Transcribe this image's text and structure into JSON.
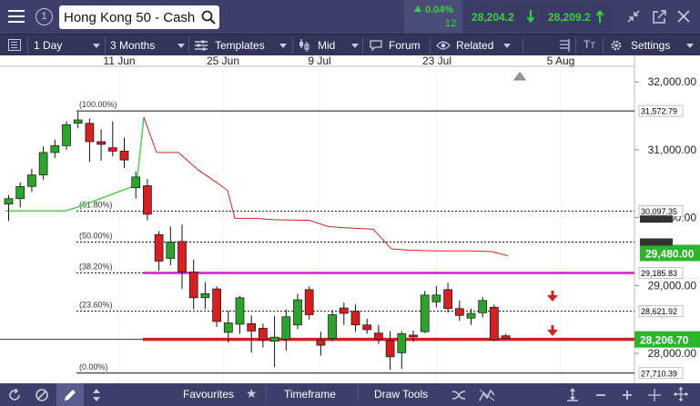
{
  "header": {
    "instrument": "Hong Kong 50 - Cash",
    "change_pct": "0.04%",
    "change_count": "12",
    "sell_price": "28,204.2",
    "buy_price": "28,209.2"
  },
  "toolbar": {
    "interval": "1 Day",
    "range": "3 Months",
    "templates": "Templates",
    "price_type": "Mid",
    "forum": "Forum",
    "related": "Related",
    "settings": "Settings"
  },
  "bottombar": {
    "favourites": "Favourites",
    "timeframe": "Timeframe",
    "draw_tools": "Draw Tools"
  },
  "chart_data": {
    "type": "candlestick",
    "x_tick_labels": [
      "11 Jun",
      "25 Jun",
      "9 Jul",
      "23 Jul",
      "5 Aug"
    ],
    "y_tick_labels": [
      "32,000.00",
      "31,000.00",
      "30,000.00",
      "29,000.00",
      "28,000.00"
    ],
    "ylim": [
      27560,
      32230
    ],
    "fib_levels": [
      {
        "label": "(100.00%)",
        "value": 31572.79,
        "tag": "31,572.79"
      },
      {
        "label": "(61.80%)",
        "value": 30097.35,
        "tag": "30,097.35"
      },
      {
        "label": "(50.00%)",
        "value": 29641,
        "tag": ""
      },
      {
        "label": "(38.20%)",
        "value": 29185.83,
        "tag": "29,185.83"
      },
      {
        "label": "(23.60%)",
        "value": 28621.92,
        "tag": "28,621.92"
      },
      {
        "label": "(0.00%)",
        "value": 27710.39,
        "tag": "27,710.39"
      }
    ],
    "current_price": {
      "value": 28206.7,
      "label": "28,206.70"
    },
    "indicator_value": {
      "value": 29480,
      "label": "29,480.00"
    },
    "candles": [
      {
        "o": 30200,
        "h": 30330,
        "l": 29950,
        "c": 30280
      },
      {
        "o": 30280,
        "h": 30520,
        "l": 30150,
        "c": 30460
      },
      {
        "o": 30460,
        "h": 30720,
        "l": 30380,
        "c": 30630
      },
      {
        "o": 30630,
        "h": 31050,
        "l": 30560,
        "c": 30960
      },
      {
        "o": 30960,
        "h": 31150,
        "l": 30880,
        "c": 31060
      },
      {
        "o": 31060,
        "h": 31420,
        "l": 31000,
        "c": 31370
      },
      {
        "o": 31390,
        "h": 31560,
        "l": 31320,
        "c": 31440
      },
      {
        "o": 31390,
        "h": 31460,
        "l": 30820,
        "c": 31120
      },
      {
        "o": 31120,
        "h": 31300,
        "l": 30840,
        "c": 31080
      },
      {
        "o": 31030,
        "h": 31420,
        "l": 30900,
        "c": 30980
      },
      {
        "o": 30980,
        "h": 31180,
        "l": 30730,
        "c": 30850
      },
      {
        "o": 30440,
        "h": 30680,
        "l": 30280,
        "c": 30600
      },
      {
        "o": 30470,
        "h": 30570,
        "l": 29960,
        "c": 30050
      },
      {
        "o": 29750,
        "h": 29800,
        "l": 29220,
        "c": 29360
      },
      {
        "o": 29400,
        "h": 29870,
        "l": 29300,
        "c": 29640
      },
      {
        "o": 29650,
        "h": 29900,
        "l": 28950,
        "c": 29200
      },
      {
        "o": 29200,
        "h": 29380,
        "l": 28650,
        "c": 28820
      },
      {
        "o": 28820,
        "h": 29050,
        "l": 28650,
        "c": 28880
      },
      {
        "o": 28950,
        "h": 28990,
        "l": 28390,
        "c": 28470
      },
      {
        "o": 28310,
        "h": 28630,
        "l": 28160,
        "c": 28450
      },
      {
        "o": 28430,
        "h": 28850,
        "l": 28290,
        "c": 28820
      },
      {
        "o": 28440,
        "h": 28560,
        "l": 28010,
        "c": 28330
      },
      {
        "o": 28370,
        "h": 28440,
        "l": 28090,
        "c": 28200
      },
      {
        "o": 28180,
        "h": 28550,
        "l": 27800,
        "c": 28240
      },
      {
        "o": 28210,
        "h": 28650,
        "l": 28040,
        "c": 28540
      },
      {
        "o": 28420,
        "h": 28880,
        "l": 28360,
        "c": 28790
      },
      {
        "o": 28940,
        "h": 28990,
        "l": 28500,
        "c": 28570
      },
      {
        "o": 28200,
        "h": 28320,
        "l": 27970,
        "c": 28120
      },
      {
        "o": 28220,
        "h": 28640,
        "l": 28180,
        "c": 28570
      },
      {
        "o": 28670,
        "h": 28750,
        "l": 28420,
        "c": 28590
      },
      {
        "o": 28620,
        "h": 28720,
        "l": 28320,
        "c": 28420
      },
      {
        "o": 28420,
        "h": 28510,
        "l": 28290,
        "c": 28350
      },
      {
        "o": 28300,
        "h": 28420,
        "l": 28140,
        "c": 28210
      },
      {
        "o": 28190,
        "h": 28330,
        "l": 27760,
        "c": 27950
      },
      {
        "o": 28010,
        "h": 28330,
        "l": 27770,
        "c": 28290
      },
      {
        "o": 28270,
        "h": 28340,
        "l": 28170,
        "c": 28260
      },
      {
        "o": 28320,
        "h": 28920,
        "l": 28300,
        "c": 28860
      },
      {
        "o": 28760,
        "h": 28990,
        "l": 28680,
        "c": 28860
      },
      {
        "o": 28940,
        "h": 29040,
        "l": 28600,
        "c": 28660
      },
      {
        "o": 28660,
        "h": 28780,
        "l": 28480,
        "c": 28560
      },
      {
        "o": 28520,
        "h": 28660,
        "l": 28420,
        "c": 28590
      },
      {
        "o": 28600,
        "h": 28830,
        "l": 28530,
        "c": 28780
      },
      {
        "o": 28680,
        "h": 28720,
        "l": 28180,
        "c": 28200
      },
      {
        "o": 28260,
        "h": 28290,
        "l": 28200,
        "c": 28220
      }
    ],
    "colors": {
      "up": "#2da32d",
      "down": "#d42020",
      "fib_highlight": "#cc22cc",
      "current_line": "#d42020",
      "green_indicator": "#44cc44",
      "red_indicator": "#d42020",
      "current_tag": "#2bb52b"
    }
  }
}
